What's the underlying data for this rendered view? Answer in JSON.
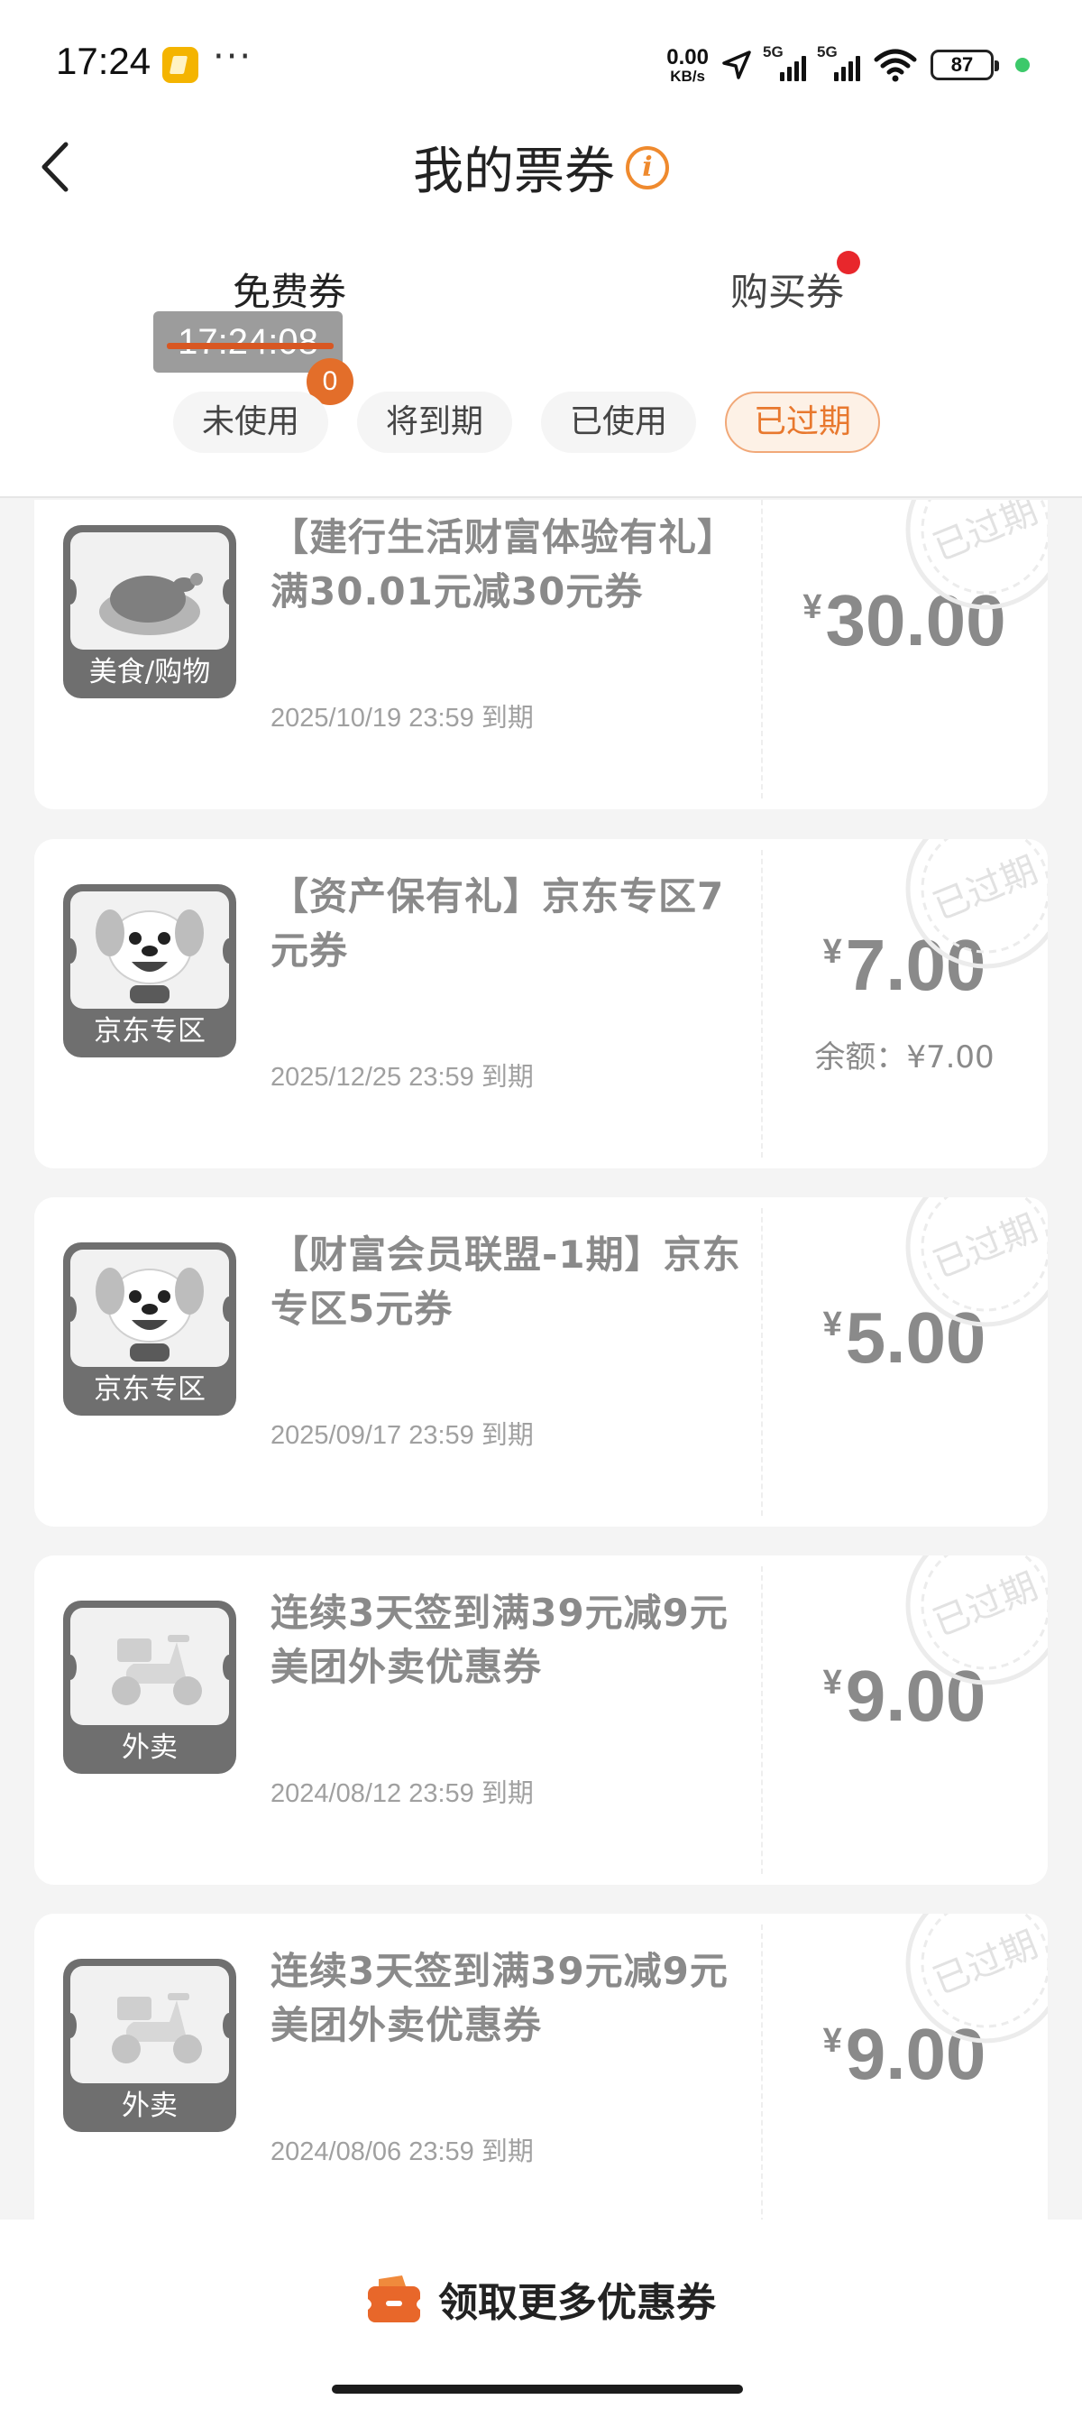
{
  "status_bar": {
    "time": "17:24",
    "menu_dots": "···",
    "net_speed_value": "0.00",
    "net_speed_unit": "KB/s",
    "sim1": "5G",
    "sim2": "5G",
    "battery": "87"
  },
  "header": {
    "title": "我的票券"
  },
  "tabs": [
    {
      "label": "免费券",
      "active": true
    },
    {
      "label": "购买券",
      "active": false,
      "has_dot": true
    }
  ],
  "overlay": {
    "timestamp": "17:24:08",
    "badge": "0"
  },
  "filters": [
    {
      "label": "未使用",
      "active": false
    },
    {
      "label": "将到期",
      "active": false
    },
    {
      "label": "已使用",
      "active": false
    },
    {
      "label": "已过期",
      "active": true
    }
  ],
  "coupons": [
    {
      "title": "【建行生活财富体验有礼】满30.01元减30元券",
      "category": "美食/购物",
      "expiry": "2025/10/19 23:59 到期",
      "currency": "¥",
      "amount": "30.00",
      "balance": "",
      "stamp": "已过期",
      "icon": "chicken-icon"
    },
    {
      "title": "【资产保有礼】京东专区7元券",
      "category": "京东专区",
      "expiry": "2025/12/25 23:59 到期",
      "currency": "¥",
      "amount": "7.00",
      "balance": "余额：¥7.00",
      "stamp": "已过期",
      "icon": "jd-dog-icon"
    },
    {
      "title": "【财富会员联盟-1期】京东专区5元券",
      "category": "京东专区",
      "expiry": "2025/09/17 23:59 到期",
      "currency": "¥",
      "amount": "5.00",
      "balance": "",
      "stamp": "已过期",
      "icon": "jd-dog-icon"
    },
    {
      "title": "连续3天签到满39元减9元美团外卖优惠券",
      "category": "外卖",
      "expiry": "2024/08/12 23:59 到期",
      "currency": "¥",
      "amount": "9.00",
      "balance": "",
      "stamp": "已过期",
      "icon": "scooter-icon"
    },
    {
      "title": "连续3天签到满39元减9元美团外卖优惠券",
      "category": "外卖",
      "expiry": "2024/08/06 23:59 到期",
      "currency": "¥",
      "amount": "9.00",
      "balance": "",
      "stamp": "已过期",
      "icon": "scooter-icon"
    }
  ],
  "bottom": {
    "more_label": "领取更多优惠券"
  },
  "colors": {
    "accent": "#ef8a2e",
    "badge_red": "#e8272c",
    "muted_text": "#8a8a8a"
  }
}
